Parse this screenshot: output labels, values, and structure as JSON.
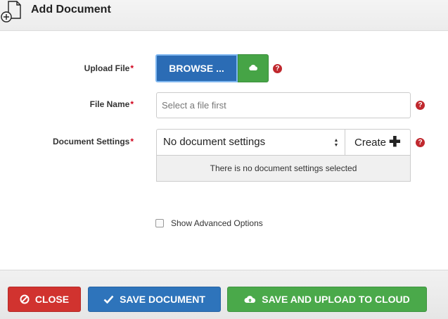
{
  "header": {
    "title": "Add Document",
    "icon": "add-document-icon"
  },
  "form": {
    "upload_file": {
      "label": "Upload File",
      "required_mark": "*",
      "browse_label": "BROWSE ...",
      "cloud_icon": "cloud-icon"
    },
    "file_name": {
      "label": "File Name",
      "required_mark": "*",
      "placeholder": "Select a file first"
    },
    "document_settings": {
      "label": "Document Settings",
      "required_mark": "*",
      "selected": "No document settings",
      "create_label": "Create",
      "create_icon": "plus-icon",
      "info": "There is no document settings selected"
    },
    "help_icon": "?",
    "advanced": {
      "label": "Show Advanced Options",
      "checked": false
    }
  },
  "footer": {
    "close_label": "CLOSE",
    "save_label": "SAVE DOCUMENT",
    "upload_label": "SAVE AND UPLOAD TO CLOUD"
  },
  "colors": {
    "close": "#d1332f",
    "save": "#2e74bb",
    "upload": "#4aa94a",
    "browse": "#2b6cb5",
    "required": "#d0021b",
    "help": "#c0282e"
  }
}
